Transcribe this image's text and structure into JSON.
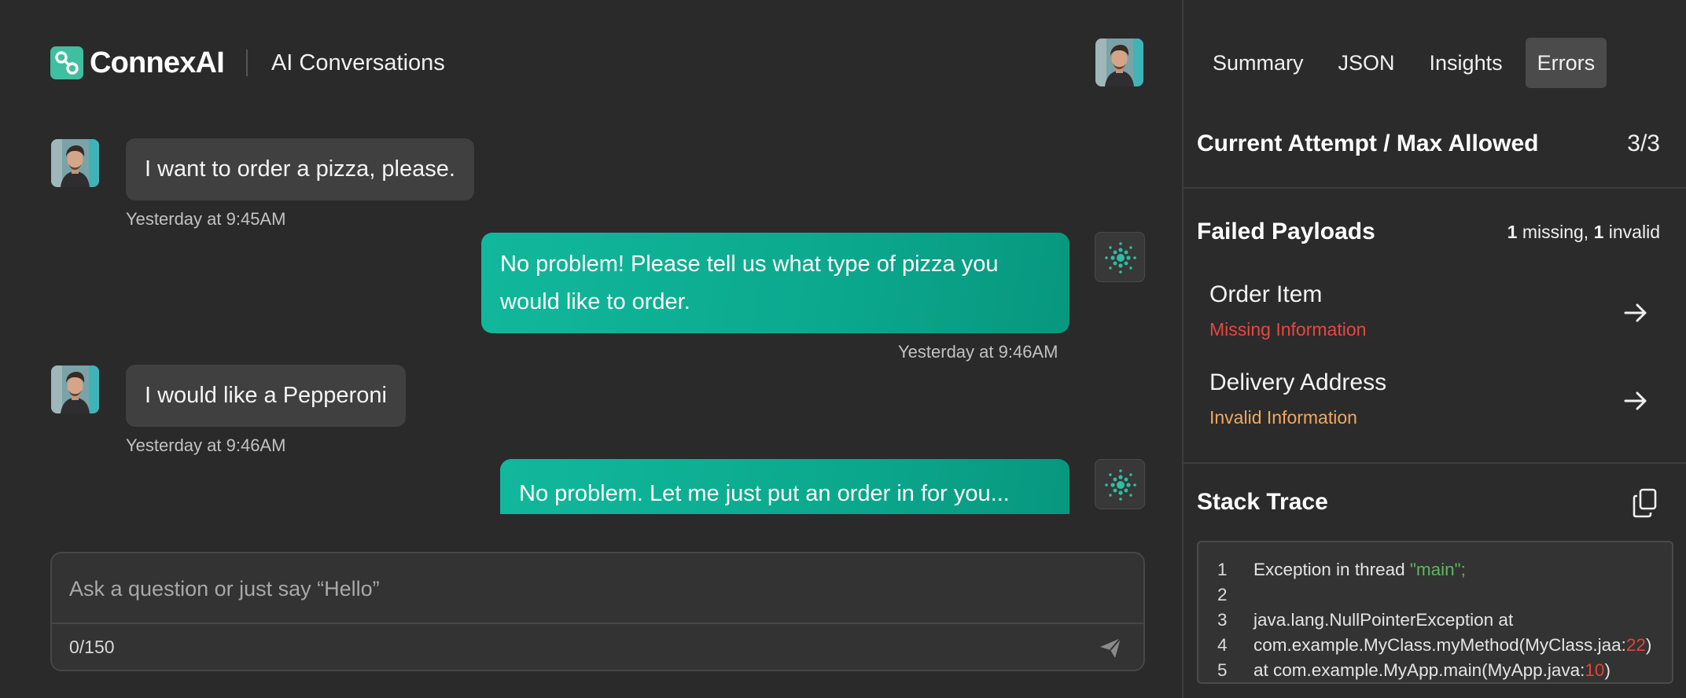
{
  "brand": {
    "name": "ConnexAI",
    "app_title": "AI Conversations"
  },
  "messages": [
    {
      "role": "user",
      "text": "I want to order a pizza, please.",
      "time": "Yesterday at 9:45AM"
    },
    {
      "role": "bot",
      "line1": "No problem! Please tell us what type of pizza you",
      "line2": "would like to order.",
      "time": "Yesterday at 9:46AM"
    },
    {
      "role": "user",
      "text": "I would like a Pepperoni",
      "time": "Yesterday at 9:46AM"
    },
    {
      "role": "bot",
      "text": "No problem. Let me just put an order in for you..."
    }
  ],
  "composer": {
    "placeholder": "Ask a question or just say “Hello”",
    "counter": "0/150"
  },
  "tabs": [
    "Summary",
    "JSON",
    "Insights",
    "Errors"
  ],
  "active_tab": "Errors",
  "attempt": {
    "label": "Current Attempt / Max Allowed",
    "value": "3/3"
  },
  "failed_payloads": {
    "title": "Failed Payloads",
    "missing_count": "1",
    "missing_label": "missing,",
    "invalid_count": "1",
    "invalid_label": "invalid",
    "items": [
      {
        "name": "Order Item",
        "status": "Missing Information",
        "status_color": "#e8473d"
      },
      {
        "name": "Delivery Address",
        "status": "Invalid Information",
        "status_color": "#f2a85b"
      }
    ]
  },
  "stack_trace": {
    "title": "Stack Trace",
    "lines": [
      {
        "n": "1",
        "a": "Exception in thread ",
        "s": "\"main\";",
        "b": ""
      },
      {
        "n": "2",
        "a": "",
        "s": "",
        "b": ""
      },
      {
        "n": "3",
        "a": "java.lang.NullPointerException at",
        "s": "",
        "b": ""
      },
      {
        "n": "4",
        "a": "com.example.MyClass.myMethod(MyClass.jaa:",
        "num": "22",
        "b": ")"
      },
      {
        "n": "5",
        "a": "at com.example.MyApp.main(MyApp.java:",
        "num": "10",
        "b": ")"
      }
    ]
  },
  "colors": {
    "accent": "#12b89c",
    "background": "#2a2a2a",
    "missing": "#e8473d",
    "invalid": "#f2a85b",
    "code_string": "#5cb85c",
    "code_number": "#e0443a"
  },
  "icons": [
    "connexai-logo-icon",
    "user-avatar-icon",
    "bot-icon",
    "send-icon",
    "arrow-right-icon",
    "copy-icon"
  ]
}
